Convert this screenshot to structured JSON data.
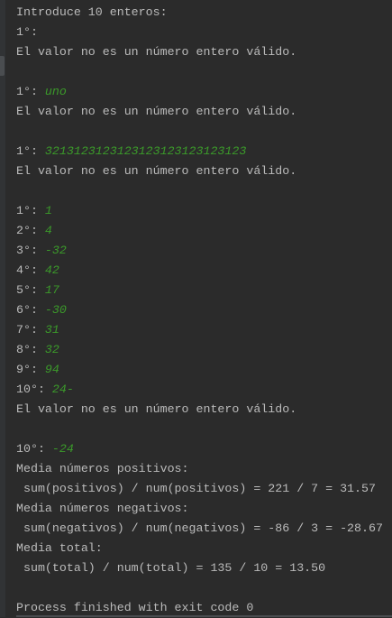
{
  "console": {
    "lines": [
      {
        "text": "Introduce 10 enteros:"
      },
      {
        "text": "1°: ",
        "input": ""
      },
      {
        "text": "El valor no es un número entero válido."
      },
      {
        "text": ""
      },
      {
        "text": "1°: ",
        "input": "uno"
      },
      {
        "text": "El valor no es un número entero válido."
      },
      {
        "text": ""
      },
      {
        "text": "1°: ",
        "input": "3213123123123123123123123123"
      },
      {
        "text": "El valor no es un número entero válido."
      },
      {
        "text": ""
      },
      {
        "text": "1°: ",
        "input": "1"
      },
      {
        "text": "2°: ",
        "input": "4"
      },
      {
        "text": "3°: ",
        "input": "-32"
      },
      {
        "text": "4°: ",
        "input": "42"
      },
      {
        "text": "5°: ",
        "input": "17"
      },
      {
        "text": "6°: ",
        "input": "-30"
      },
      {
        "text": "7°: ",
        "input": "31"
      },
      {
        "text": "8°: ",
        "input": "32"
      },
      {
        "text": "9°: ",
        "input": "94"
      },
      {
        "text": "10°: ",
        "input": "24-"
      },
      {
        "text": "El valor no es un número entero válido."
      },
      {
        "text": ""
      },
      {
        "text": "10°: ",
        "input": "-24"
      },
      {
        "text": "Media números positivos:"
      },
      {
        "text": " sum(positivos) / num(positivos) = 221 / 7 = 31.57"
      },
      {
        "text": "Media números negativos:"
      },
      {
        "text": " sum(negativos) / num(negativos) = -86 / 3 = -28.67"
      },
      {
        "text": "Media total:"
      },
      {
        "text": " sum(total) / num(total) = 135 / 10 = 13.50"
      },
      {
        "text": ""
      },
      {
        "text": "Process finished with exit code 0"
      }
    ]
  },
  "colors": {
    "background": "#2b2b2b",
    "text": "#bbbbbb",
    "user_input": "#3b9a2a"
  }
}
